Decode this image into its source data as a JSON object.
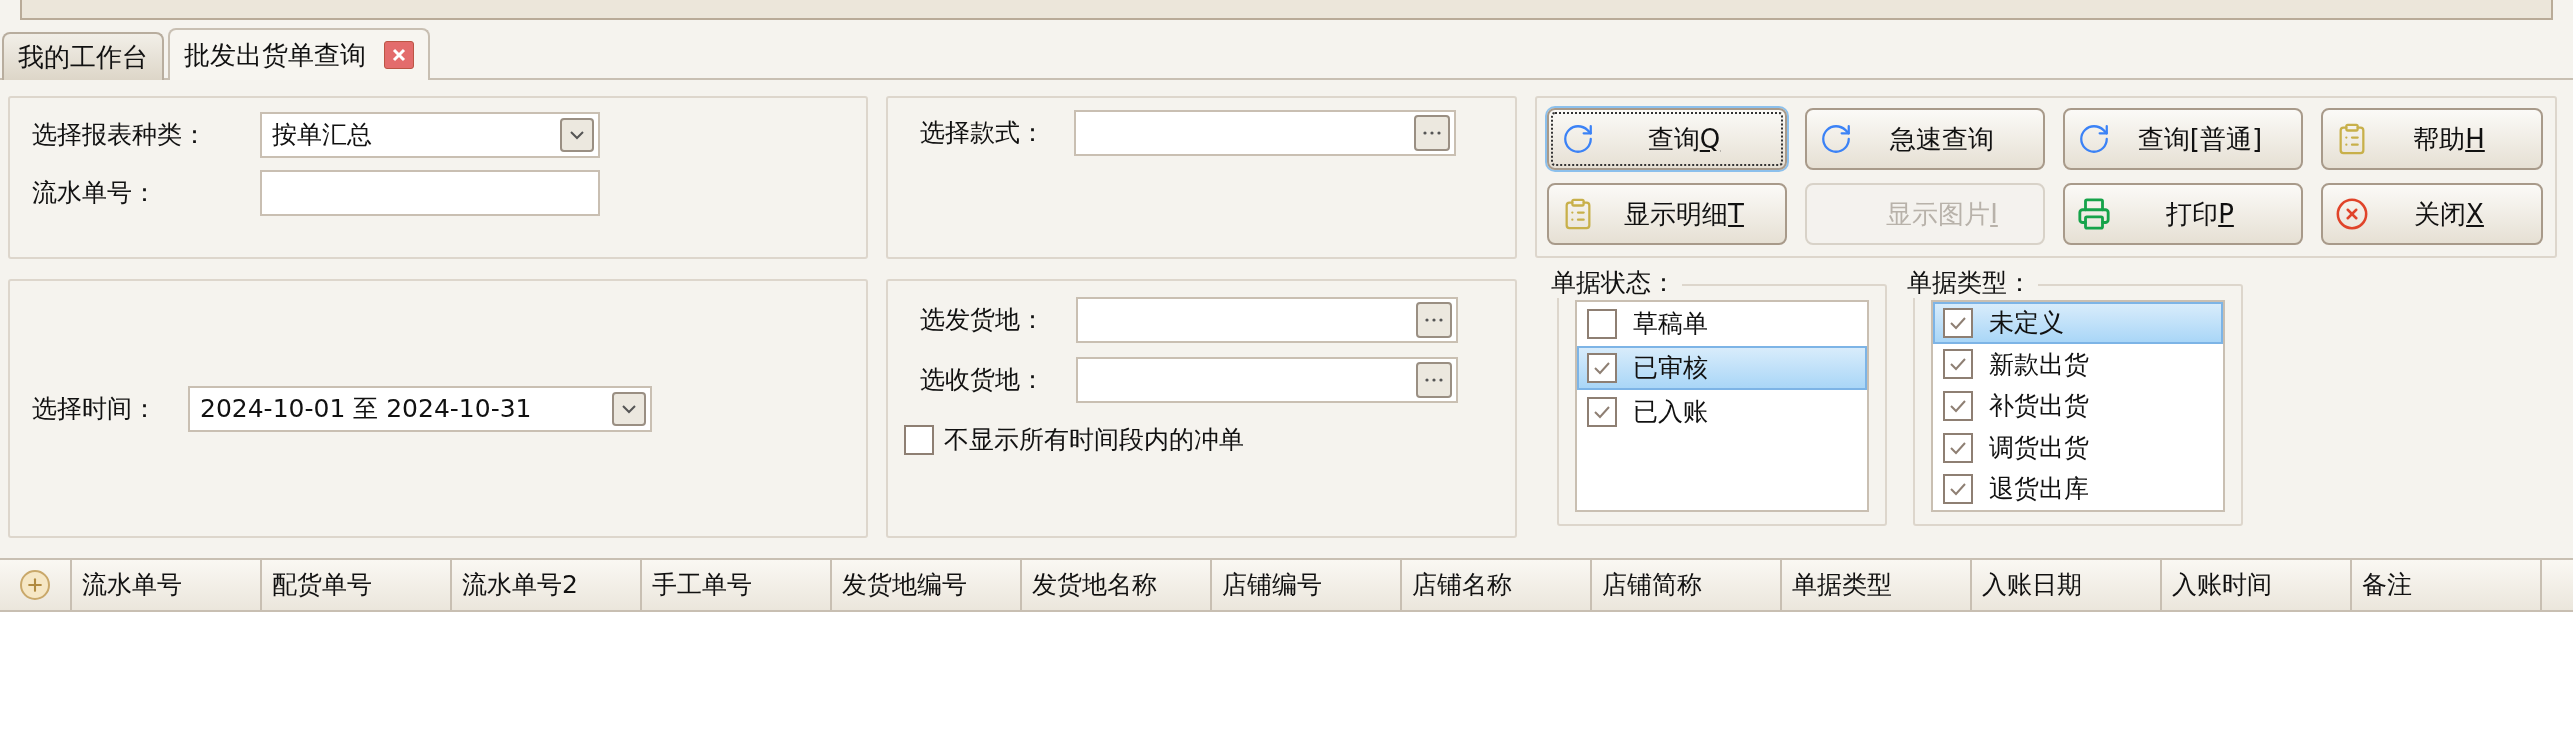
{
  "tabs": [
    {
      "label": "我的工作台",
      "selected": false,
      "closable": false
    },
    {
      "label": "批发出货单查询",
      "selected": true,
      "closable": true
    }
  ],
  "report_panel": {
    "report_type": {
      "label": "选择报表种类：",
      "value": "按单汇总"
    },
    "serial_no": {
      "label": "流水单号："
    }
  },
  "style_panel": {
    "style": {
      "label": "选择款式："
    }
  },
  "time_panel": {
    "time": {
      "label": "选择时间：",
      "value": "2024-10-01 至 2024-10-31"
    }
  },
  "place_panel": {
    "ship_from": {
      "label": "选发货地："
    },
    "ship_to": {
      "label": "选收货地："
    },
    "hide_reversals": {
      "label": "不显示所有时间段内的冲单",
      "checked": false
    }
  },
  "buttons": [
    {
      "label": "查询",
      "accel": "Q",
      "kind": "refresh",
      "focused": true,
      "disabled": false
    },
    {
      "label": "急速查询",
      "kind": "refresh",
      "focused": false,
      "disabled": false
    },
    {
      "label": "查询[普通]",
      "kind": "refresh",
      "focused": false,
      "disabled": false
    },
    {
      "label": "帮助",
      "accel": "H",
      "kind": "note",
      "focused": false,
      "disabled": false
    },
    {
      "label": "显示明细",
      "accel": "T",
      "kind": "note",
      "focused": false,
      "disabled": false
    },
    {
      "label": "显示图片",
      "accel": "I",
      "kind": "plain",
      "focused": false,
      "disabled": true
    },
    {
      "label": "打印",
      "accel": "P",
      "kind": "print",
      "focused": false,
      "disabled": false
    },
    {
      "label": "关闭",
      "accel": "X",
      "kind": "close",
      "focused": false,
      "disabled": false
    }
  ],
  "status_group": {
    "title": "单据状态：",
    "items": [
      {
        "label": "草稿单",
        "checked": false,
        "selected": false
      },
      {
        "label": "已审核",
        "checked": true,
        "selected": true
      },
      {
        "label": "已入账",
        "checked": true,
        "selected": false
      }
    ]
  },
  "type_group": {
    "title": "单据类型：",
    "items": [
      {
        "label": "未定义",
        "checked": true,
        "selected": true
      },
      {
        "label": "新款出货",
        "checked": true,
        "selected": false
      },
      {
        "label": "补货出货",
        "checked": true,
        "selected": false
      },
      {
        "label": "调货出货",
        "checked": true,
        "selected": false
      },
      {
        "label": "退货出库",
        "checked": true,
        "selected": false
      }
    ]
  },
  "table": {
    "columns": [
      "流水单号",
      "配货单号",
      "流水单号2",
      "手工单号",
      "发货地编号",
      "发货地名称",
      "店铺编号",
      "店铺名称",
      "店铺简称",
      "单据类型",
      "入账日期",
      "入账时间",
      "备注"
    ]
  }
}
